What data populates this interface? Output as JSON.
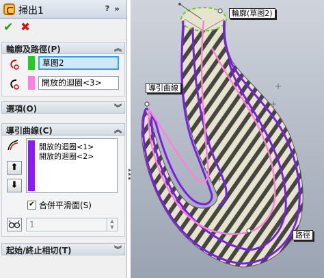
{
  "title": "掃出1",
  "title_bar": {
    "help_icon": "?",
    "more_icon": "»"
  },
  "confirm": {
    "ok": "✔",
    "cancel": "✖"
  },
  "colors": {
    "profile_swatch": "#22cc22",
    "path_swatch": "#ff80e0",
    "guide_swatch": "#8b1aff",
    "guide_curve": "#7a1ee6",
    "path_curve": "#ff80e0",
    "profile_ring": "#6ecc22"
  },
  "sections": {
    "profile_path": {
      "label": "輪廓及路徑(P)",
      "profile_value": "草图2",
      "path_value": "開放的迴圈<3>"
    },
    "options": {
      "label": "選項(O)"
    },
    "guide_curves": {
      "label": "導引曲線(C)",
      "items": [
        "開放的迴圈<1>",
        "開放的迴圈<2>"
      ],
      "up_icon": "⬆",
      "down_icon": "⬇",
      "merge_label": "合併平滑面(S)",
      "merge_checked": "✔",
      "spin_value": "1"
    },
    "tangency": {
      "label": "起始/終止相切(T)"
    }
  },
  "viewport": {
    "callouts": {
      "profile": "輪廓(草图2)",
      "guide": "導引曲線",
      "path": "路徑"
    }
  }
}
